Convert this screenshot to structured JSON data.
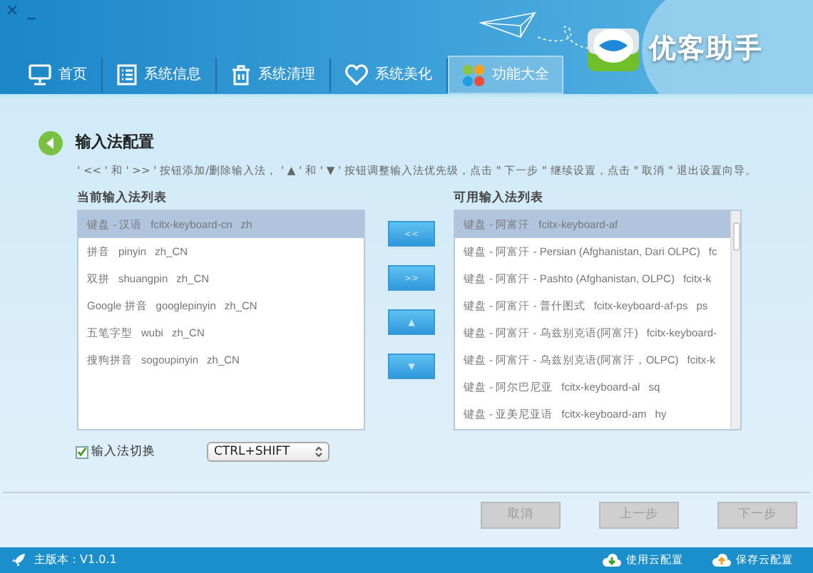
{
  "window": {
    "controls": [
      "✕",
      "_"
    ]
  },
  "app_name": "优客助手",
  "tabs": [
    {
      "label": "首页",
      "kind": "monitor",
      "selected": false
    },
    {
      "label": "系统信息",
      "kind": "list",
      "selected": false
    },
    {
      "label": "系统清理",
      "kind": "trash",
      "selected": false
    },
    {
      "label": "系统美化",
      "kind": "heart",
      "selected": false
    },
    {
      "label": "功能大全",
      "kind": "apps",
      "selected": true
    }
  ],
  "page": {
    "title": "输入法配置",
    "description": "' << ' 和 ' >> ' 按钮添加/删除输入法， ' ▲ ' 和 ' ▼ ' 按钮调整输入法优先级，点击 \" 下一步 \" 继续设置，点击 \" 取消 \" 退出设置向导。"
  },
  "current_list": {
    "label": "当前输入法列表",
    "rows": [
      {
        "parts": [
          "键盘 - 汉语",
          "fcitx-keyboard-cn",
          "zh"
        ],
        "selected": true
      },
      {
        "parts": [
          "拼音",
          "pinyin",
          "zh_CN"
        ],
        "selected": false
      },
      {
        "parts": [
          "双拼",
          "shuangpin",
          "zh_CN"
        ],
        "selected": false
      },
      {
        "parts": [
          "Google 拼音",
          "googlepinyin",
          "zh_CN"
        ],
        "selected": false
      },
      {
        "parts": [
          "五笔字型",
          "wubi",
          "zh_CN"
        ],
        "selected": false
      },
      {
        "parts": [
          "搜狗拼音",
          "sogoupinyin",
          "zh_CN"
        ],
        "selected": false
      }
    ]
  },
  "move_buttons": [
    "<<",
    ">>",
    "▲",
    "▼"
  ],
  "available_list": {
    "label": "可用输入法列表",
    "rows": [
      {
        "parts": [
          "键盘 - 阿富汗",
          "fcitx-keyboard-af"
        ],
        "selected": true
      },
      {
        "parts": [
          "键盘 - 阿富汗 - Persian (Afghanistan, Dari OLPC)",
          "fc"
        ],
        "selected": false
      },
      {
        "parts": [
          "键盘 - 阿富汗 - Pashto (Afghanistan, OLPC)",
          "fcitx-k"
        ],
        "selected": false
      },
      {
        "parts": [
          "键盘 - 阿富汗 - 普什图式",
          "fcitx-keyboard-af-ps",
          "ps"
        ],
        "selected": false
      },
      {
        "parts": [
          "键盘 - 阿富汗 - 乌兹别克语(阿富汗)",
          "fcitx-keyboard-"
        ],
        "selected": false
      },
      {
        "parts": [
          "键盘 - 阿富汗 - 乌兹别克语(阿富汗，OLPC)",
          "fcitx-k"
        ],
        "selected": false
      },
      {
        "parts": [
          "键盘 - 阿尔巴尼亚",
          "fcitx-keyboard-al",
          "sq"
        ],
        "selected": false
      },
      {
        "parts": [
          "键盘 - 亚美尼亚语",
          "fcitx-keyboard-am",
          "hy"
        ],
        "selected": false
      }
    ]
  },
  "switch": {
    "label": "输入法切换",
    "checked": true,
    "value": "CTRL+SHIFT"
  },
  "wizard_buttons": [
    {
      "label": "取消",
      "disabled": true
    },
    {
      "label": "上一步",
      "disabled": true
    },
    {
      "label": "下一步",
      "disabled": true
    }
  ],
  "status_bar": {
    "version": "主版本：V1.0.1",
    "actions": [
      {
        "label": "使用云配置",
        "kind": "download"
      },
      {
        "label": "保存云配置",
        "kind": "upload"
      }
    ]
  }
}
